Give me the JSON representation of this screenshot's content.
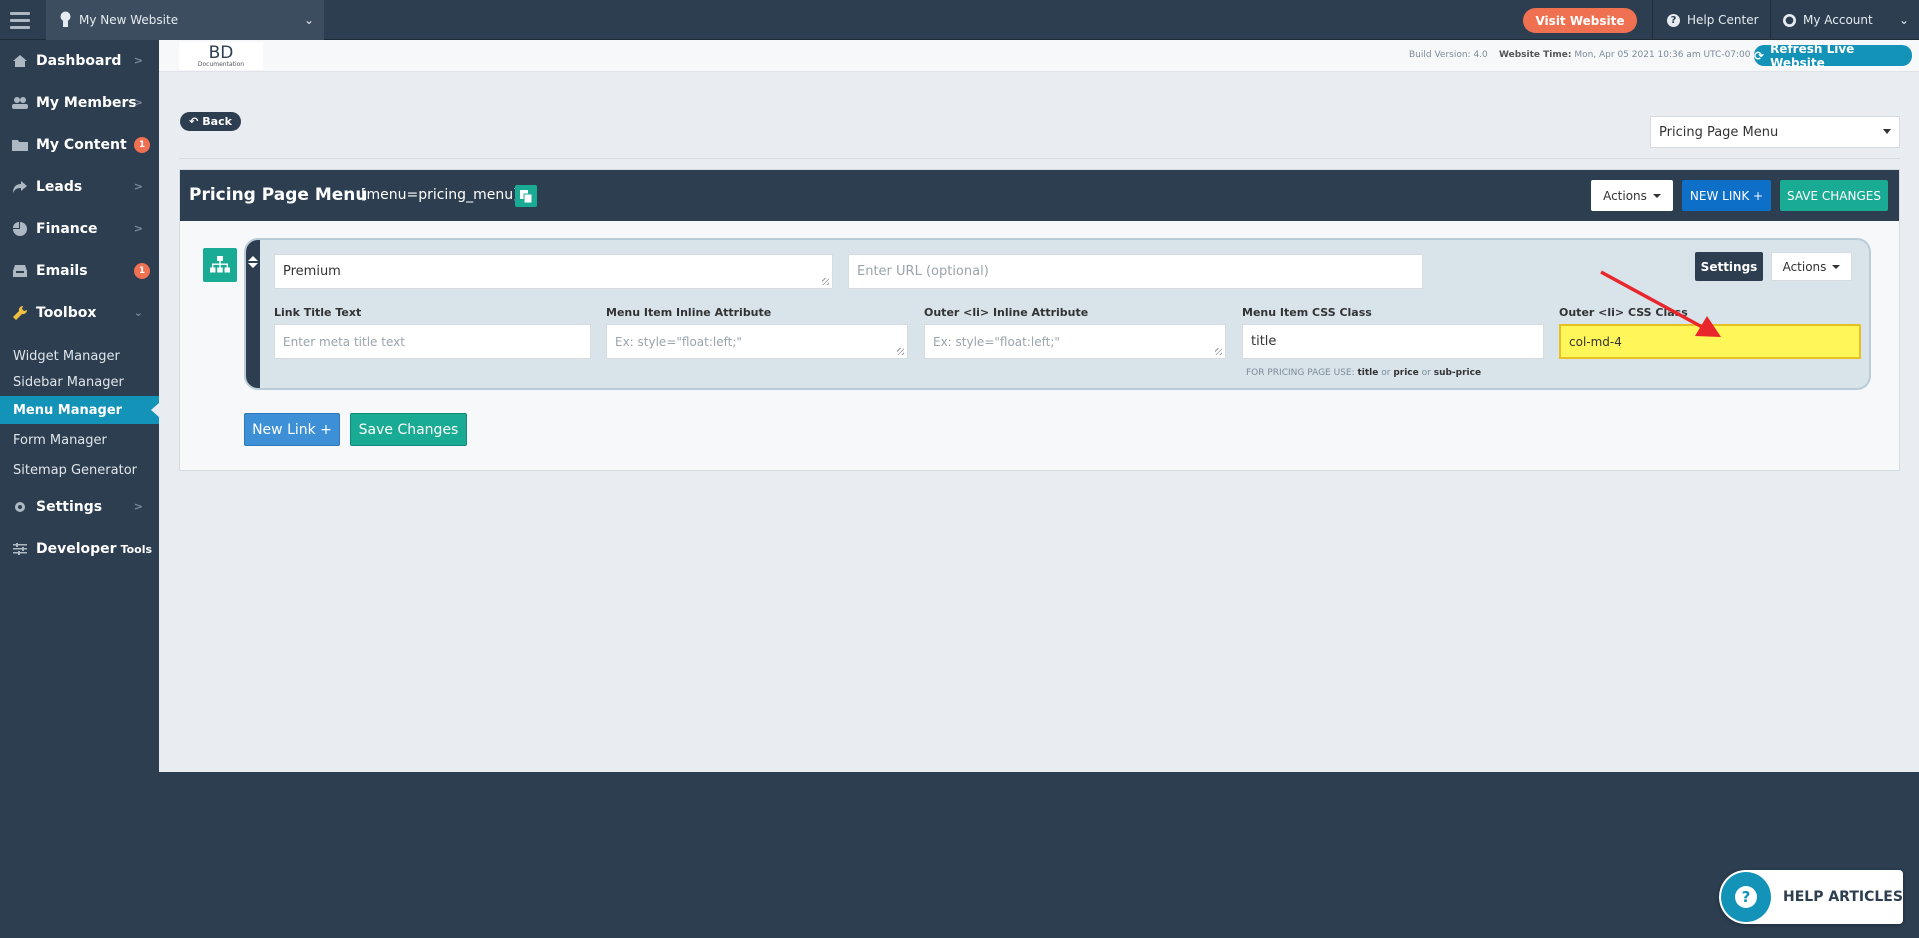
{
  "topbar": {
    "site_name": "My New Website",
    "visit_label": "Visit Website",
    "help_center_label": "Help Center",
    "account_label": "My Account"
  },
  "sidebar": {
    "items": [
      {
        "label": "Dashboard",
        "icon": "home-icon"
      },
      {
        "label": "My Members",
        "icon": "users-icon"
      },
      {
        "label": "My Content",
        "icon": "folder-icon",
        "badge": "1"
      },
      {
        "label": "Leads",
        "icon": "share-icon"
      },
      {
        "label": "Finance",
        "icon": "pie-chart-icon"
      },
      {
        "label": "Emails",
        "icon": "inbox-icon",
        "badge": "1"
      },
      {
        "label": "Toolbox",
        "icon": "wrench-icon"
      }
    ],
    "toolbox_sub": [
      "Widget Manager",
      "Sidebar Manager",
      "Menu Manager",
      "Form Manager",
      "Sitemap Generator"
    ],
    "settings_label": "Settings",
    "developer_label": "Developer",
    "developer_suffix": "Tools"
  },
  "subheader": {
    "logo_text": "BD",
    "logo_sub": "Documentation",
    "build_label": "Build Version: 4.0",
    "website_time_label": "Website Time:",
    "website_time_value": "Mon, Apr 05 2021 10:36 am UTC-07:00",
    "refresh_label": "Refresh Live Website"
  },
  "back_label": "Back",
  "menu_select_value": "Pricing Page Menu",
  "panel": {
    "title": "Pricing Page Menu",
    "shortcode": "[menu=pricing_menu]",
    "actions_label": "Actions",
    "new_link_label": "NEW LINK +",
    "save_label": "SAVE CHANGES"
  },
  "menu_item": {
    "title_value": "Premium",
    "url_placeholder": "Enter URL (optional)",
    "settings_label": "Settings",
    "actions_label": "Actions",
    "link_title_label": "Link Title Text",
    "link_title_placeholder": "Enter meta title text",
    "inline_attr_label": "Menu Item Inline Attribute",
    "inline_attr_placeholder": "Ex: style=\"float:left;\"",
    "outer_inline_label": "Outer <li> Inline Attribute",
    "outer_inline_placeholder": "Ex: style=\"float:left;\"",
    "css_class_label": "Menu Item CSS Class",
    "css_class_value": "title",
    "outer_css_label": "Outer <li> CSS Class",
    "outer_css_value": "col-md-4",
    "note_prefix": "FOR PRICING PAGE USE:",
    "note_opt1": "title",
    "note_or1": "or",
    "note_opt2": "price",
    "note_or2": "or",
    "note_opt3": "sub-price"
  },
  "bottom": {
    "new_link_label": "New Link +",
    "save_label": "Save Changes"
  },
  "help_articles_label": "HELP ARTICLES",
  "colors": {
    "navy": "#2c3e50",
    "teal": "#1aab94",
    "blue": "#0d6fc7",
    "orange": "#f07052",
    "highlight": "#fff65a",
    "arrow": "#e8262b"
  }
}
